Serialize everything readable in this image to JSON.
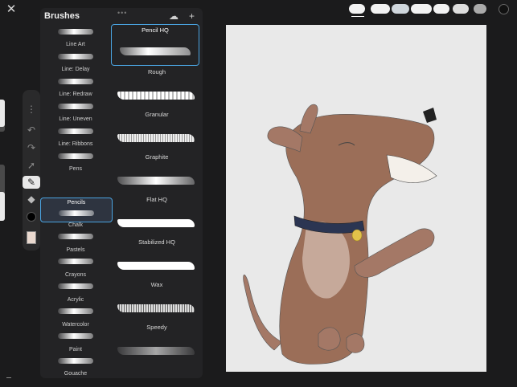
{
  "topbar": {
    "close_icon": "close-icon",
    "recent_brushes": [
      "brush-1",
      "brush-2",
      "brush-3",
      "brush-4",
      "brush-5",
      "brush-6",
      "brush-7",
      "brush-8"
    ],
    "color_swatch": "#111111"
  },
  "toolbar": {
    "tools": [
      "more-icon",
      "undo-icon",
      "redo-icon",
      "select-icon",
      "brush-icon",
      "eraser-icon",
      "color-icon",
      "layer-icon"
    ],
    "active_tool": "brush-icon"
  },
  "brushes_panel": {
    "title": "Brushes",
    "handle": "•••",
    "cloud_icon": "cloud-import-icon",
    "add_icon": "add-icon",
    "add_label": "+",
    "libraries": [
      {
        "label": "Line Art"
      },
      {
        "label": "Line: Delay"
      },
      {
        "label": "Line: Redraw"
      },
      {
        "label": "Line: Uneven"
      },
      {
        "label": "Line: Ribbons"
      },
      {
        "label": "Pens"
      },
      {
        "label": "Pencils",
        "selected": true
      },
      {
        "label": "Chalk"
      },
      {
        "label": "Pastels"
      },
      {
        "label": "Crayons"
      },
      {
        "label": "Acrylic"
      },
      {
        "label": "Watercolor"
      },
      {
        "label": "Paint"
      },
      {
        "label": "Gouache"
      }
    ],
    "brushes": [
      {
        "name": "Pencil HQ",
        "selected": true
      },
      {
        "name": "Rough"
      },
      {
        "name": "Granular"
      },
      {
        "name": "Graphite"
      },
      {
        "name": "Flat HQ"
      },
      {
        "name": "Stabilized HQ"
      },
      {
        "name": "Wax"
      },
      {
        "name": "Speedy"
      }
    ]
  },
  "colors": {
    "selection": "#4aa3e0",
    "canvas": "#e9e9e9",
    "dog": "#9b6e58",
    "collar": "#2b3552",
    "tag": "#e2c24a"
  }
}
